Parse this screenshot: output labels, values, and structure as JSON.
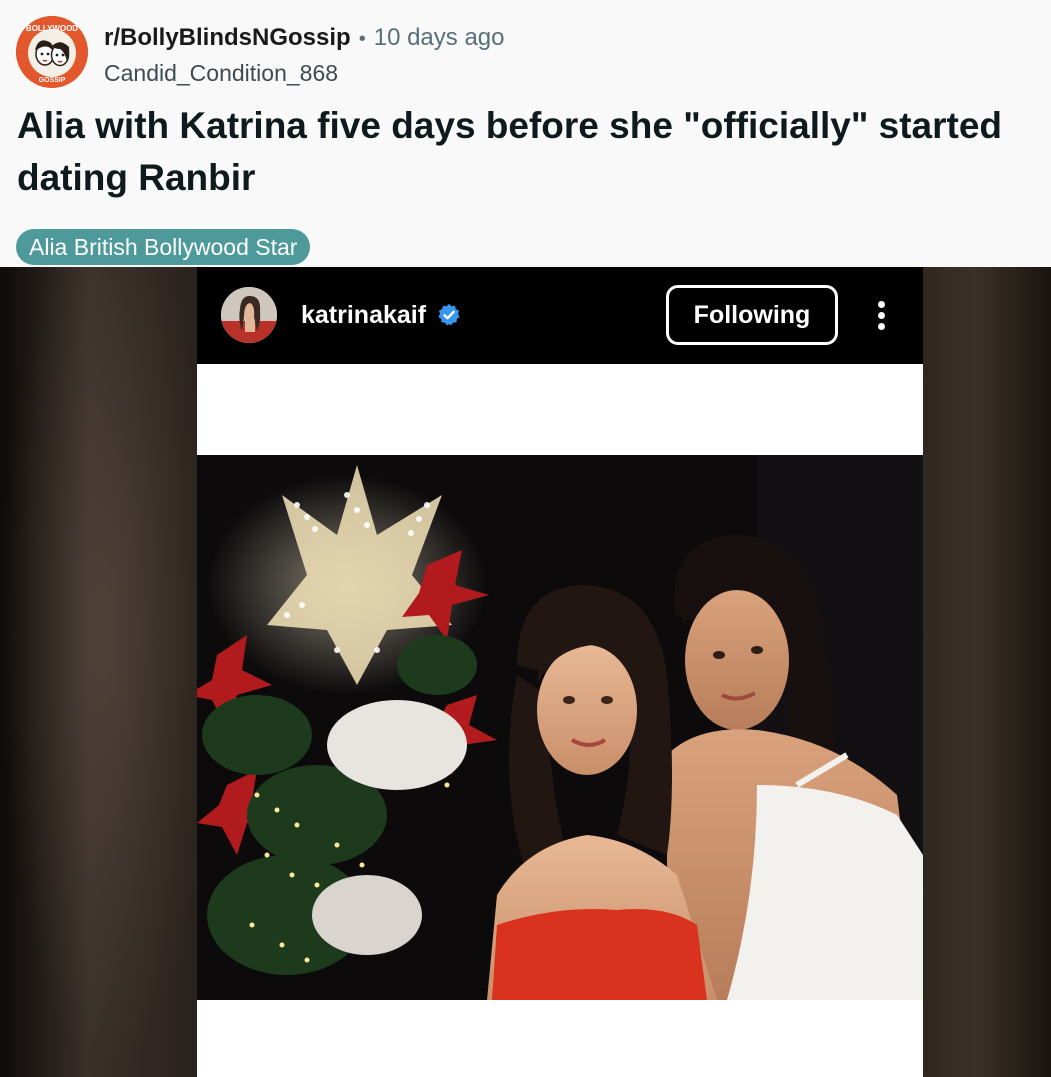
{
  "post": {
    "subreddit": "r/BollyBlindsNGossip",
    "separator": "•",
    "time_ago": "10 days ago",
    "author": "Candid_Condition_868",
    "title": "Alia with Katrina five days before she \"officially\" started dating Ranbir",
    "flair": "Alia British Bollywood Star",
    "subreddit_avatar": {
      "icon": "bollywood-gossip-logo-icon",
      "logo_text_top": "BOLLYWOOD",
      "logo_text_bottom": "GOSSIP",
      "color": "#e2572c"
    }
  },
  "instagram_post": {
    "username": "katrinakaif",
    "verified_icon": "verified-badge-icon",
    "follow_label": "Following",
    "more_icon": "more-vertical-icon",
    "verified_color": "#3897f0"
  },
  "colors": {
    "flair_bg": "#4e9a9a",
    "text_primary": "#0f1a1c",
    "text_secondary": "#576f76",
    "page_bg": "#f9f9f9"
  }
}
